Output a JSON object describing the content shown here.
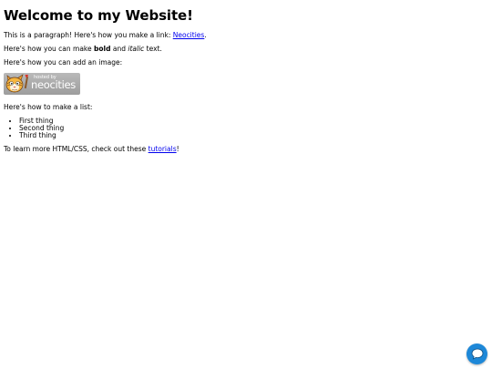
{
  "page": {
    "heading": "Welcome to my Website!",
    "p1_text": "This is a paragraph! Here's how you make a link: ",
    "p1_link": "Neocities",
    "p1_end": ".",
    "p2_text1": "Here's how you can make ",
    "p2_bold": "bold",
    "p2_text2": " and ",
    "p2_italic": "italic",
    "p2_text3": " text.",
    "p3_text": "Here's how you can add an image:",
    "badge": {
      "small_text": "hosted by",
      "big_text": "neocities"
    },
    "p4_text": "Here's how to make a list:",
    "list": [
      "First thing",
      "Second thing",
      "Third thing"
    ],
    "p5_text": "To learn more HTML/CSS, check out these ",
    "p5_link": "tutorials",
    "p5_end": "!"
  },
  "chat_widget": {
    "icon": "chat-bubble-icon",
    "color": "#1e88d8"
  }
}
